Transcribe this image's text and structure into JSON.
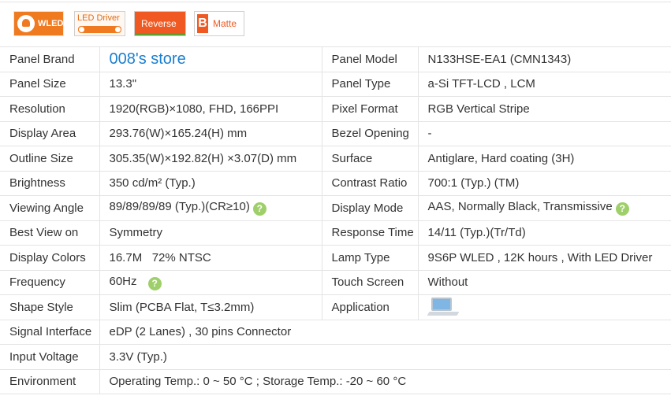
{
  "badges": {
    "wled": "WLED",
    "led_driver": "LED Driver",
    "reverse": "Reverse",
    "matte_letter": "B",
    "matte": "Matte"
  },
  "specs": {
    "panel_brand": {
      "label": "Panel Brand",
      "value": "008's store"
    },
    "panel_model": {
      "label": "Panel Model",
      "value": "N133HSE-EA1 (CMN1343)"
    },
    "panel_size": {
      "label": "Panel Size",
      "value": "13.3\""
    },
    "panel_type": {
      "label": "Panel Type",
      "value": "a-Si TFT-LCD , LCM"
    },
    "resolution": {
      "label": "Resolution",
      "value": "1920(RGB)×1080, FHD, 166PPI"
    },
    "pixel_format": {
      "label": "Pixel Format",
      "value": "RGB Vertical Stripe"
    },
    "display_area": {
      "label": "Display Area",
      "value": "293.76(W)×165.24(H) mm"
    },
    "bezel_opening": {
      "label": "Bezel Opening",
      "value": "-"
    },
    "outline_size": {
      "label": "Outline Size",
      "value": "305.35(W)×192.82(H) ×3.07(D) mm"
    },
    "surface": {
      "label": "Surface",
      "value": "Antiglare, Hard coating (3H)"
    },
    "brightness": {
      "label": "Brightness",
      "value": "350 cd/m² (Typ.)"
    },
    "contrast_ratio": {
      "label": "Contrast Ratio",
      "value": "700:1 (Typ.) (TM)"
    },
    "viewing_angle": {
      "label": "Viewing Angle",
      "value": "89/89/89/89 (Typ.)(CR≥10)"
    },
    "display_mode": {
      "label": "Display Mode",
      "value": "AAS, Normally Black, Transmissive"
    },
    "best_view_on": {
      "label": "Best View on",
      "value": "Symmetry"
    },
    "response_time": {
      "label": "Response Time",
      "value": "14/11 (Typ.)(Tr/Td)"
    },
    "display_colors": {
      "label": "Display Colors",
      "value": "16.7M   72% NTSC"
    },
    "lamp_type": {
      "label": "Lamp Type",
      "value": "9S6P WLED , 12K hours , With LED Driver"
    },
    "frequency": {
      "label": "Frequency",
      "value": "60Hz"
    },
    "touch_screen": {
      "label": "Touch Screen",
      "value": "Without"
    },
    "shape_style": {
      "label": "Shape Style",
      "value": "Slim (PCBA Flat, T≤3.2mm)"
    },
    "application": {
      "label": "Application",
      "icon": "laptop-icon"
    },
    "signal_interface": {
      "label": "Signal Interface",
      "value": "eDP (2 Lanes) , 30 pins Connector"
    },
    "input_voltage": {
      "label": "Input Voltage",
      "value": "3.3V (Typ.)"
    },
    "environment": {
      "label": "Environment",
      "value": "Operating Temp.: 0 ~ 50 °C ; Storage Temp.: -20 ~ 60 °C"
    }
  },
  "help_glyph": "?",
  "colors": {
    "link": "#1a7fd0",
    "accent": "#f07a1f",
    "help": "#9fcf6a"
  }
}
